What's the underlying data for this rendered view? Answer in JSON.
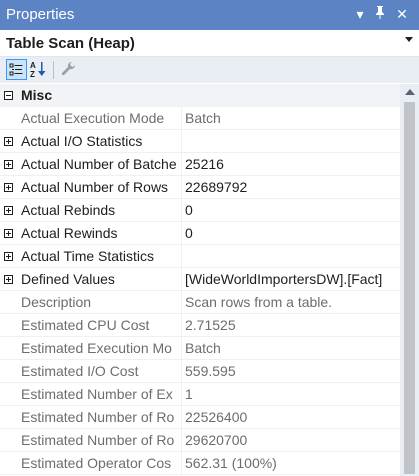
{
  "window": {
    "title": "Properties",
    "buttons": {
      "dropdown": "▾",
      "pin": "📌",
      "close": "✕"
    }
  },
  "object_selector": {
    "selected": "Table Scan (Heap)"
  },
  "toolbar": {
    "categorized_icon": "categorized-icon",
    "alphabetical_icon": "alphabetical-sort-icon",
    "property_pages_icon": "wrench-icon"
  },
  "grid": {
    "category": {
      "label": "Misc",
      "expander": "minus"
    },
    "rows": [
      {
        "name": "Actual Execution Mode",
        "value": "Batch",
        "expander": "",
        "style": "gray"
      },
      {
        "name": "Actual I/O Statistics",
        "value": "",
        "expander": "plus",
        "style": "dark"
      },
      {
        "name": "Actual Number of Batche",
        "value": "25216",
        "expander": "plus",
        "style": "dark"
      },
      {
        "name": "Actual Number of Rows",
        "value": "22689792",
        "expander": "plus",
        "style": "dark"
      },
      {
        "name": "Actual Rebinds",
        "value": "0",
        "expander": "plus",
        "style": "dark"
      },
      {
        "name": "Actual Rewinds",
        "value": "0",
        "expander": "plus",
        "style": "dark"
      },
      {
        "name": "Actual Time Statistics",
        "value": "",
        "expander": "plus",
        "style": "dark"
      },
      {
        "name": "Defined Values",
        "value": "[WideWorldImportersDW].[Fact]",
        "expander": "plus",
        "style": "dark"
      },
      {
        "name": "Description",
        "value": "Scan rows from a table.",
        "expander": "",
        "style": "gray"
      },
      {
        "name": "Estimated CPU Cost",
        "value": "2.71525",
        "expander": "",
        "style": "gray"
      },
      {
        "name": "Estimated Execution Mo",
        "value": "Batch",
        "expander": "",
        "style": "gray"
      },
      {
        "name": "Estimated I/O Cost",
        "value": "559.595",
        "expander": "",
        "style": "gray"
      },
      {
        "name": "Estimated Number of Ex",
        "value": "1",
        "expander": "",
        "style": "gray"
      },
      {
        "name": "Estimated Number of Ro",
        "value": "22526400",
        "expander": "",
        "style": "gray"
      },
      {
        "name": "Estimated Number of Ro",
        "value": "29620700",
        "expander": "",
        "style": "gray"
      },
      {
        "name": "Estimated Operator Cos",
        "value": "562.31 (100%)",
        "expander": "",
        "style": "gray"
      }
    ]
  },
  "colors": {
    "titlebar": "#5c84c4",
    "toolbar": "#e9edf4",
    "category_bg": "#f2f3f6",
    "text_dark": "#1e1e1e",
    "text_gray": "#6d6d6d"
  }
}
